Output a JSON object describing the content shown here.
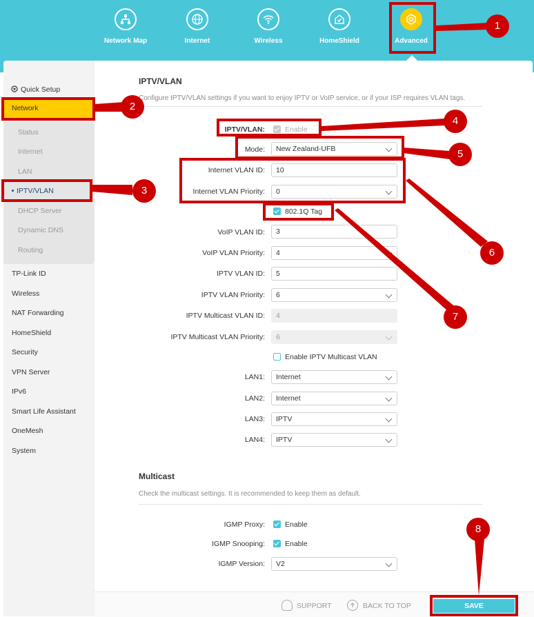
{
  "nav": {
    "items": [
      {
        "label": "Network Map",
        "icon": "network-map-icon"
      },
      {
        "label": "Internet",
        "icon": "globe-icon"
      },
      {
        "label": "Wireless",
        "icon": "wifi-icon"
      },
      {
        "label": "HomeShield",
        "icon": "shield-icon"
      },
      {
        "label": "Advanced",
        "icon": "gear-icon",
        "active": true
      }
    ]
  },
  "sidebar": {
    "quick_setup": "Quick Setup",
    "network": "Network",
    "sub": [
      "Status",
      "Internet",
      "LAN",
      "IPTV/VLAN",
      "DHCP Server",
      "Dynamic DNS",
      "Routing"
    ],
    "items": [
      "TP-Link ID",
      "Wireless",
      "NAT Forwarding",
      "HomeShield",
      "Security",
      "VPN Server",
      "IPv6",
      "Smart Life Assistant",
      "OneMesh",
      "System"
    ]
  },
  "iptv": {
    "title": "IPTV/VLAN",
    "description": "Configure IPTV/VLAN settings if you want to enjoy IPTV or VoIP service, or if your ISP requires VLAN tags.",
    "toggle_label": "IPTV/VLAN:",
    "toggle_text": "Enable",
    "mode_label": "Mode:",
    "mode_value": "New Zealand-UFB",
    "internet_vlan_id_label": "Internet VLAN ID:",
    "internet_vlan_id": "10",
    "internet_vlan_priority_label": "Internet VLAN Priority:",
    "internet_vlan_priority": "0",
    "tag_label": "802.1Q Tag",
    "voip_vlan_id_label": "VoIP VLAN ID:",
    "voip_vlan_id": "3",
    "voip_vlan_priority_label": "VoIP VLAN Priority:",
    "voip_vlan_priority": "4",
    "iptv_vlan_id_label": "IPTV VLAN ID:",
    "iptv_vlan_id": "5",
    "iptv_vlan_priority_label": "IPTV VLAN Priority:",
    "iptv_vlan_priority": "6",
    "mc_vlan_id_label": "IPTV Multicast VLAN ID:",
    "mc_vlan_id": "4",
    "mc_vlan_priority_label": "IPTV Multicast VLAN Priority:",
    "mc_vlan_priority": "6",
    "enable_mc_label": "Enable IPTV Multicast VLAN",
    "lan1_label": "LAN1:",
    "lan1": "Internet",
    "lan2_label": "LAN2:",
    "lan2": "Internet",
    "lan3_label": "LAN3:",
    "lan3": "IPTV",
    "lan4_label": "LAN4:",
    "lan4": "IPTV"
  },
  "multicast": {
    "title": "Multicast",
    "description": "Check the multicast settings. It is recommended to keep them as default.",
    "igmp_proxy_label": "IGMP Proxy:",
    "igmp_proxy_text": "Enable",
    "igmp_snooping_label": "IGMP Snooping:",
    "igmp_snooping_text": "Enable",
    "igmp_version_label": "IGMP Version:",
    "igmp_version": "V2"
  },
  "footer": {
    "support": "SUPPORT",
    "back_to_top": "BACK TO TOP",
    "save": "SAVE"
  },
  "annotations": [
    "1",
    "2",
    "3",
    "4",
    "5",
    "6",
    "7",
    "8"
  ],
  "colors": {
    "accent": "#4ac6d9",
    "highlight": "#ffcc00",
    "annotation": "#cc0000"
  }
}
